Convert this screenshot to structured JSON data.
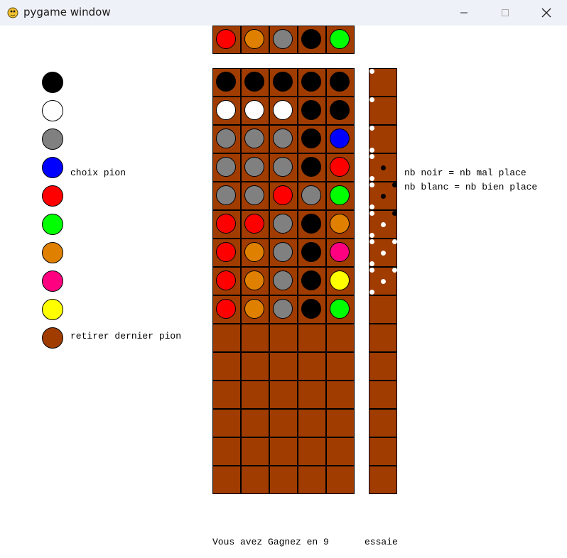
{
  "window": {
    "title": "pygame window"
  },
  "colors": {
    "black": "#000000",
    "white": "#ffffff",
    "gray": "#808080",
    "blue": "#0000ff",
    "red": "#ff0000",
    "green": "#00ff00",
    "orange": "#e08000",
    "pink": "#ff0080",
    "yellow": "#ffff00",
    "brown": "#a03c00"
  },
  "palette": {
    "colors": [
      "black",
      "white",
      "gray",
      "blue",
      "red",
      "green",
      "orange",
      "pink",
      "yellow",
      "brown"
    ],
    "choose_label": "choix pion",
    "remove_label": "retirer dernier pion"
  },
  "secret_code": [
    "red",
    "orange",
    "gray",
    "black",
    "green"
  ],
  "board": {
    "rows_total": 15,
    "guesses": [
      [
        "black",
        "black",
        "black",
        "black",
        "black"
      ],
      [
        "white",
        "white",
        "white",
        "black",
        "black"
      ],
      [
        "gray",
        "gray",
        "gray",
        "black",
        "blue"
      ],
      [
        "gray",
        "gray",
        "gray",
        "black",
        "red"
      ],
      [
        "gray",
        "gray",
        "red",
        "gray",
        "green"
      ],
      [
        "red",
        "red",
        "gray",
        "black",
        "orange"
      ],
      [
        "red",
        "orange",
        "gray",
        "black",
        "pink"
      ],
      [
        "red",
        "orange",
        "gray",
        "black",
        "yellow"
      ],
      [
        "red",
        "orange",
        "gray",
        "black",
        "green"
      ]
    ],
    "feedback": [
      {
        "white": 1,
        "black": 0
      },
      {
        "white": 1,
        "black": 0
      },
      {
        "white": 2,
        "black": 0
      },
      {
        "white": 2,
        "black": 1
      },
      {
        "white": 2,
        "black": 2
      },
      {
        "white": 3,
        "black": 1
      },
      {
        "white": 4,
        "black": 0
      },
      {
        "white": 4,
        "black": 0
      }
    ]
  },
  "legend": {
    "black_line": "nb noir = nb mal place",
    "white_line": "nb blanc = nb bien place"
  },
  "status": {
    "message": "Vous avez Gagnez en 9",
    "suffix": "essaie"
  }
}
